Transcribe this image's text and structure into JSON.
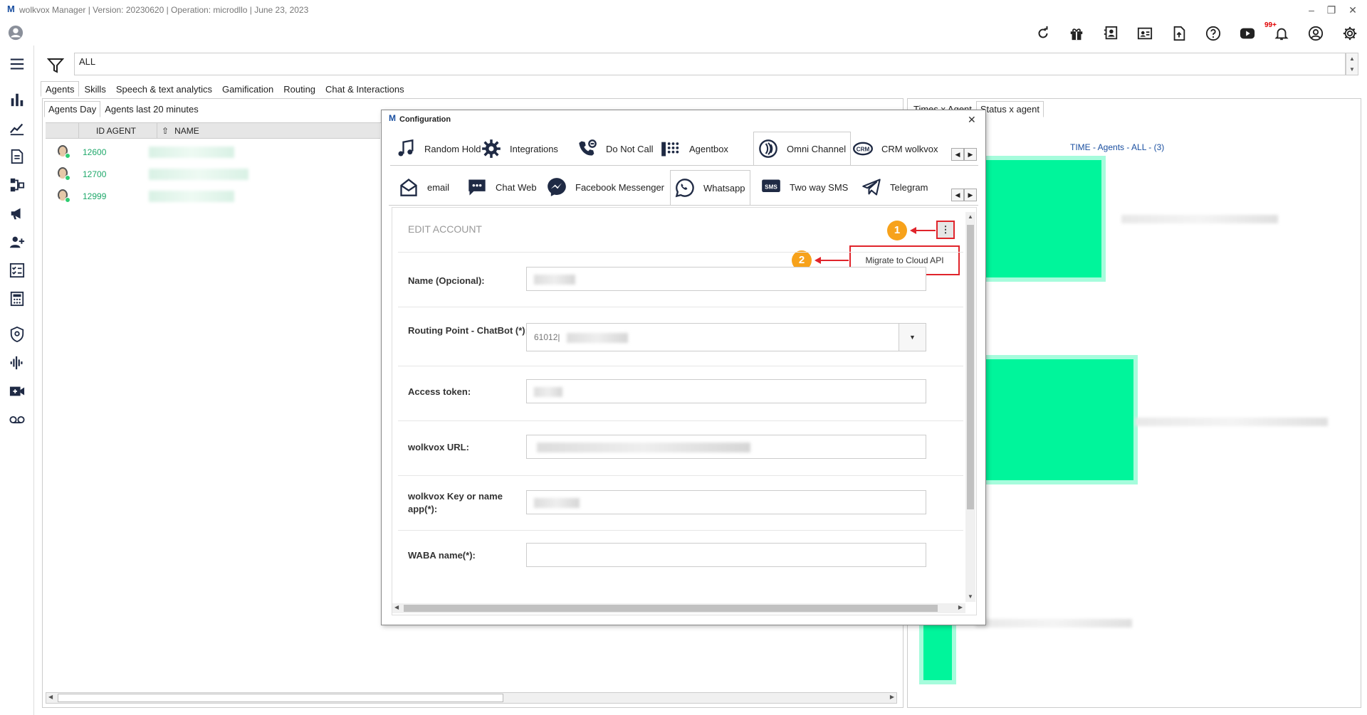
{
  "app": {
    "logo": "M",
    "title": "wolkvox Manager  | Version: 20230620 |  Operation: microdllo | June 23, 2023",
    "window_controls": [
      "–",
      "❐",
      "✕"
    ]
  },
  "toolbar": {
    "icons": [
      "refresh-icon",
      "gift-icon",
      "contacts-icon",
      "id-card-icon",
      "document-upload-icon",
      "help-icon",
      "youtube-icon",
      "bell-icon",
      "user-circle-icon",
      "gear-icon"
    ],
    "notification_count": "99+"
  },
  "sidebar": {
    "icons": [
      "avatar-icon",
      "hamburger-menu-icon",
      "bar-chart-icon",
      "line-chart-icon",
      "document-icon",
      "diagram-icon",
      "megaphone-icon",
      "team-add-icon",
      "checklist-icon",
      "calculator-icon",
      "shield-icon",
      "audio-wave-icon",
      "video-add-icon",
      "voicemail-icon"
    ]
  },
  "filter": {
    "value": "ALL",
    "spin_up": "▲",
    "spin_down": "▼"
  },
  "main_tabs": [
    "Agents",
    "Skills",
    "Speech & text analytics",
    "Gamification",
    "Routing",
    "Chat & Interactions"
  ],
  "left_panel": {
    "sub_tabs": [
      "Agents Day",
      "Agents last 20 minutes"
    ],
    "columns": [
      "ID AGENT",
      "NAME"
    ],
    "rows": [
      {
        "id": "12600"
      },
      {
        "id": "12700"
      },
      {
        "id": "12999"
      }
    ],
    "scroll_left": "◀",
    "scroll_right": "▶"
  },
  "right_panel": {
    "tabs": [
      "Times x Agent",
      "Status x agent"
    ],
    "chart_title": "TIME - Agents - ALL -  (3)"
  },
  "modal": {
    "logo": "M",
    "title": "Configuration",
    "close": "✕",
    "config_tabs": [
      {
        "label": "Random Hold",
        "icon": "music-note-icon"
      },
      {
        "label": "Integrations",
        "icon": "gear-icon"
      },
      {
        "label": "Do Not Call",
        "icon": "phone-block-icon"
      },
      {
        "label": "Agentbox",
        "icon": "dialpad-icon"
      },
      {
        "label": "Omni Channel",
        "icon": "omni-channel-icon"
      },
      {
        "label": "CRM wolkvox",
        "icon": "crm-icon"
      }
    ],
    "channel_tabs": [
      {
        "label": "email",
        "icon": "email-icon"
      },
      {
        "label": "Chat Web",
        "icon": "chat-icon"
      },
      {
        "label": "Facebook Messenger",
        "icon": "messenger-icon"
      },
      {
        "label": "Whatsapp",
        "icon": "whatsapp-icon"
      },
      {
        "label": "Two way SMS",
        "icon": "sms-icon"
      },
      {
        "label": "Telegram",
        "icon": "telegram-icon"
      }
    ],
    "tab_scroll_left": "◀",
    "tab_scroll_right": "▶",
    "form": {
      "heading": "EDIT ACCOUNT",
      "menu_button": "⋮",
      "menu_item": "Migrate to Cloud API",
      "fields": [
        {
          "label": "Name (Opcional):"
        },
        {
          "label": "Routing Point - ChatBot (*):",
          "value_prefix": "61012|",
          "dropdown": "▼"
        },
        {
          "label": "Access token:"
        },
        {
          "label": "wolkvox URL:"
        },
        {
          "label": "wolkvox Key or name app(*):"
        },
        {
          "label": "WABA name(*):"
        }
      ],
      "scroll_up": "▲",
      "scroll_down": "▼",
      "scroll_left": "◀",
      "scroll_right": "▶"
    },
    "callouts": [
      "1",
      "2"
    ]
  },
  "colors": {
    "accent_red": "#e0242b",
    "badge_orange": "#f7a21b",
    "bar_green": "#00f59b",
    "id_green": "#1ea86a",
    "chart_title_blue": "#1a4fa0"
  }
}
